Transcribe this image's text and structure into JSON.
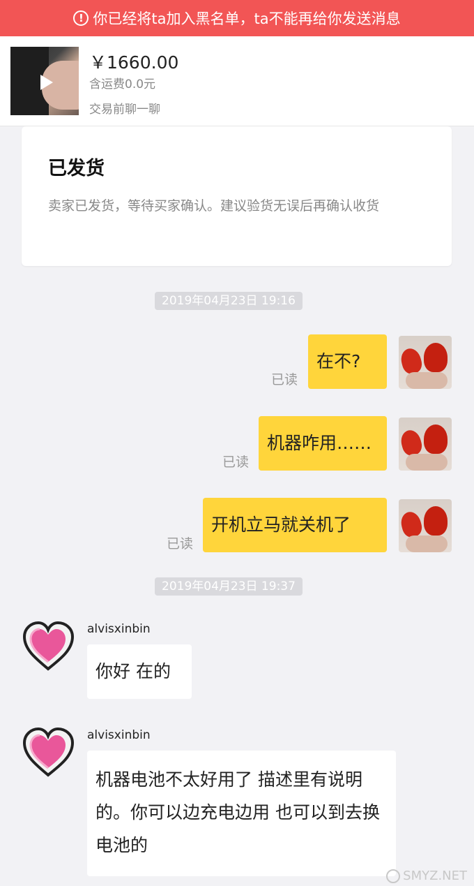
{
  "banner": {
    "text": "你已经将ta加入黑名单，ta不能再给你发送消息",
    "icon": "alert-circle-icon",
    "color": "#f25555"
  },
  "product": {
    "price": "￥1660.00",
    "shipping": "含运费0.0元",
    "chat_prompt": "交易前聊一聊"
  },
  "status_card": {
    "title": "已发货",
    "description": "卖家已发货，等待买家确认。建议验货无误后再确认收货"
  },
  "chat": {
    "timestamp1": "2019年04月23日 19:16",
    "timestamp2": "2019年04月23日 19:37",
    "read_label": "已读",
    "outgoing": [
      {
        "text": "在不?"
      },
      {
        "text": "机器咋用……"
      },
      {
        "text": "开机立马就关机了"
      }
    ],
    "incoming": [
      {
        "username": "alvisxinbin",
        "text": "你好 在的"
      },
      {
        "username": "alvisxinbin",
        "text": "机器电池不太好用了 描述里有说明的。你可以边充电边用 也可以到去换电池的"
      }
    ]
  },
  "watermark": "SMYZ.NET",
  "colors": {
    "bubble_outgoing": "#ffd53b",
    "bubble_incoming": "#ffffff",
    "background": "#f2f2f5"
  }
}
